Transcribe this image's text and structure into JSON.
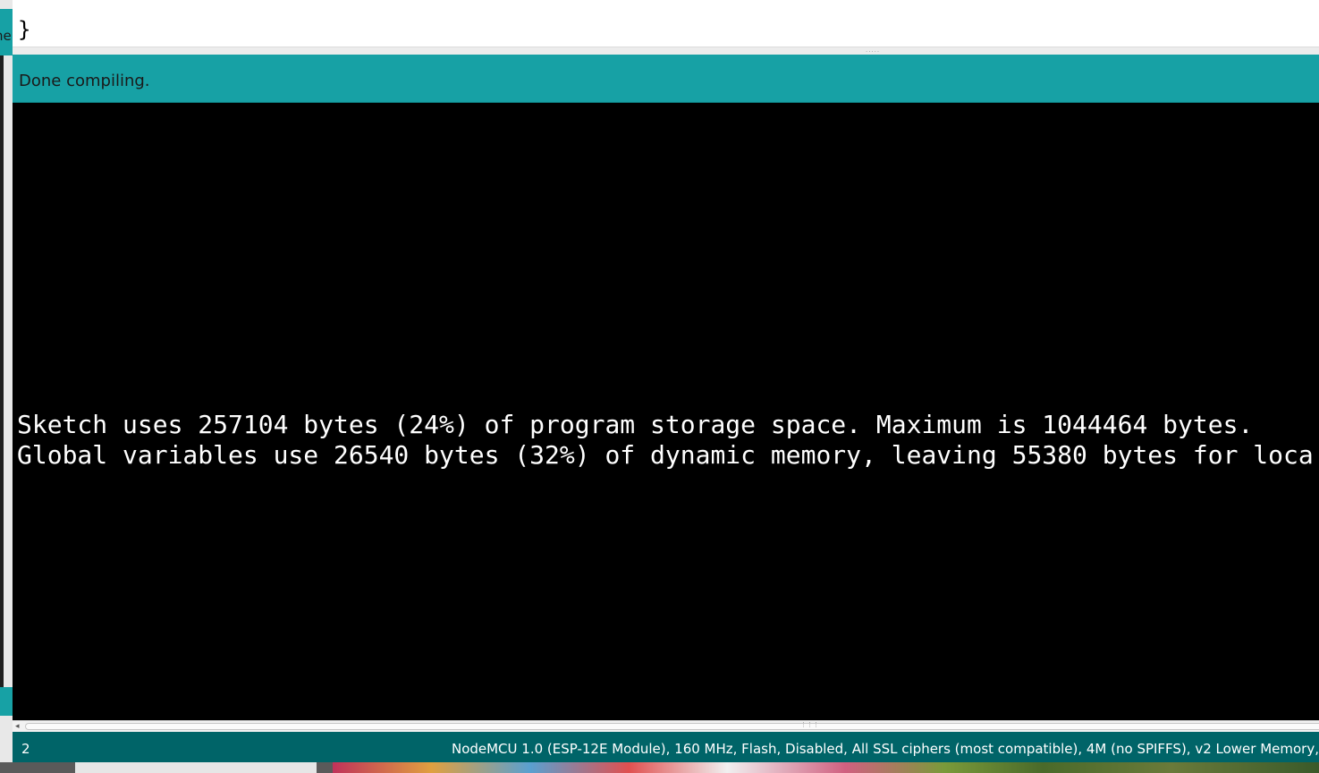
{
  "background_window": {
    "tab_fragment": "ne"
  },
  "editor": {
    "visible_code": "}"
  },
  "status": {
    "message": "Done compiling."
  },
  "console": {
    "lines": [
      "Sketch uses 257104 bytes (24%) of program storage space. Maximum is 1044464 bytes.",
      "Global variables use 26540 bytes (32%) of dynamic memory, leaving 55380 bytes for loca"
    ]
  },
  "footer": {
    "line_number": "2",
    "board_info": "NodeMCU 1.0 (ESP-12E Module), 160 MHz, Flash, Disabled, All SSL ciphers (most compatible), 4M (no SPIFFS), v2 Lower Memory,"
  },
  "colors": {
    "teal": "#17a1a5",
    "dark_teal": "#006468",
    "console_bg": "#000000",
    "console_text": "#ffffff"
  }
}
